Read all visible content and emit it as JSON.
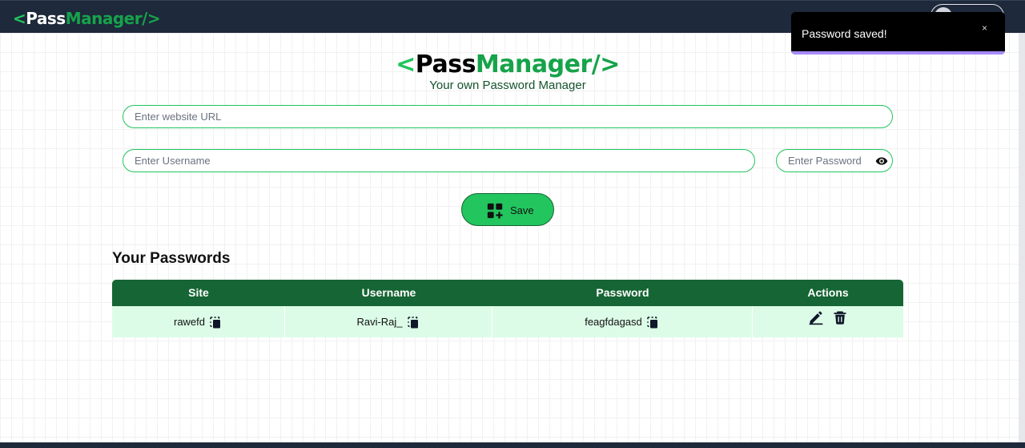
{
  "navbar": {
    "logo": {
      "lt": "<",
      "pass": "Pass",
      "manager": "Manager/>"
    }
  },
  "header": {
    "title": {
      "lt": "<",
      "pass": "Pass",
      "manager": "Manager/>"
    },
    "subtitle": "Your own Password Manager"
  },
  "form": {
    "url_placeholder": "Enter website URL",
    "url_value": "",
    "username_placeholder": "Enter Username",
    "username_value": "",
    "password_placeholder": "Enter Password",
    "password_value": "",
    "save_label": "Save"
  },
  "passwords": {
    "title": "Your Passwords",
    "columns": [
      "Site",
      "Username",
      "Password",
      "Actions"
    ],
    "rows": [
      {
        "site": "rawefd",
        "username": "Ravi-Raj_",
        "password": "feagfdagasd"
      }
    ]
  },
  "toast": {
    "message": "Password saved!",
    "close": "×",
    "progress": 1.0
  },
  "colors": {
    "accent": "#22c55e",
    "header_bg": "#166534",
    "row_bg": "#dcfce7",
    "nav_bg": "#1e293b"
  },
  "icons": [
    "avatar-icon",
    "eye-icon",
    "add-grid-icon",
    "copy-icon",
    "edit-icon",
    "delete-icon",
    "close-icon"
  ]
}
